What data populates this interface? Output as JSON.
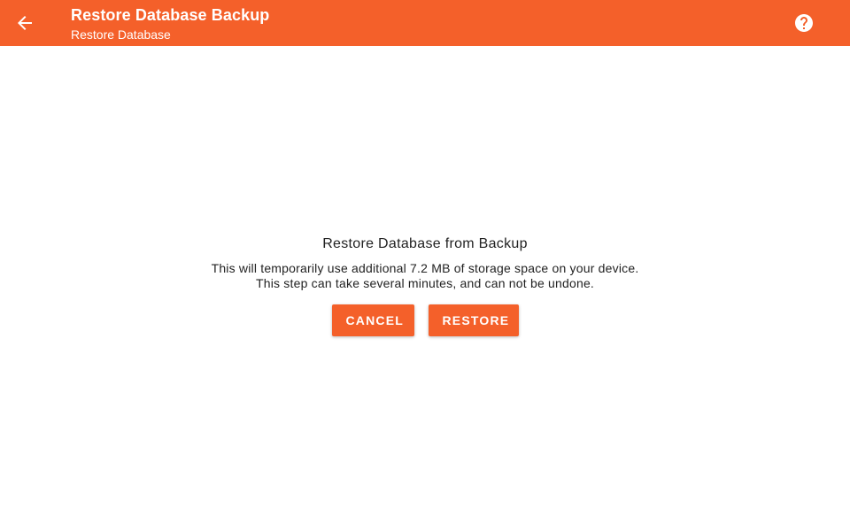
{
  "app_bar": {
    "title": "Restore Database Backup",
    "subtitle": "Restore Database",
    "back_icon": "arrow-back-icon",
    "help_icon": "help-circle-icon",
    "color": "#f4602a"
  },
  "main": {
    "heading": "Restore Database from Backup",
    "description_line1": "This will temporarily use additional 7.2 MB of storage space on your device.",
    "description_line2": "This step can take several minutes, and can not be undone.",
    "cancel_label": "CANCEL",
    "restore_label": "RESTORE"
  }
}
